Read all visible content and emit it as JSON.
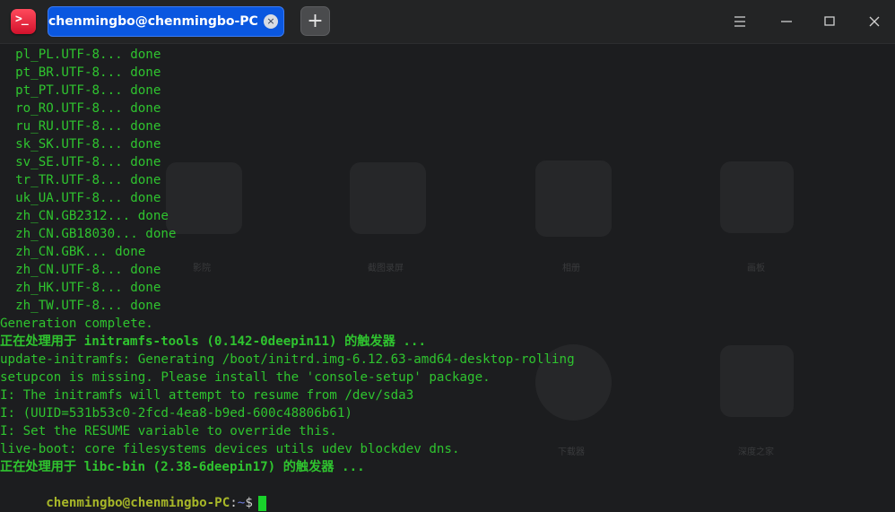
{
  "titlebar": {
    "tab_title": "chenmingbo@chenmingbo-PC: ~",
    "tab_close_icon": "×",
    "new_tab_icon": "+"
  },
  "colors": {
    "terminal_green": "#2fc42f",
    "prompt_user": "#a7b728",
    "prompt_path": "#6c7ad8",
    "cursor": "#19d22b",
    "tab_active": "#0a57e0"
  },
  "terminal": {
    "lines": [
      "  pl_PL.UTF-8... done",
      "  pt_BR.UTF-8... done",
      "  pt_PT.UTF-8... done",
      "  ro_RO.UTF-8... done",
      "  ru_RU.UTF-8... done",
      "  sk_SK.UTF-8... done",
      "  sv_SE.UTF-8... done",
      "  tr_TR.UTF-8... done",
      "  uk_UA.UTF-8... done",
      "  zh_CN.GB2312... done",
      "  zh_CN.GB18030... done",
      "  zh_CN.GBK... done",
      "  zh_CN.UTF-8... done",
      "  zh_HK.UTF-8... done",
      "  zh_TW.UTF-8... done",
      "Generation complete.",
      "正在处理用于 initramfs-tools (0.142-0deepin11) 的触发器 ...",
      "update-initramfs: Generating /boot/initrd.img-6.12.63-amd64-desktop-rolling",
      "setupcon is missing. Please install the 'console-setup' package.",
      "I: The initramfs will attempt to resume from /dev/sda3",
      "I: (UUID=531b53c0-2fcd-4ea8-b9ed-600c48806b61)",
      "I: Set the RESUME variable to override this.",
      "live-boot: core filesystems devices utils udev blockdev dns.",
      "正在处理用于 libc-bin (2.38-6deepin17) 的触发器 ..."
    ],
    "prompt": {
      "user_host": "chenmingbo@chenmingbo-PC",
      "separator": ":",
      "path": "~",
      "symbol": "$"
    }
  },
  "background_labels": [
    "影院",
    "截图录屏",
    "相册",
    "画板",
    "下载器",
    "深度之家"
  ]
}
